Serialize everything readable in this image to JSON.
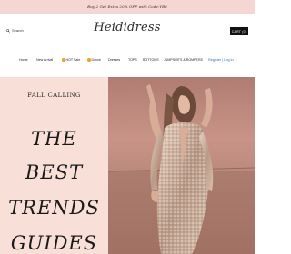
{
  "promo": {
    "text": "Buy 2 Get Extra 20% OFF with Code:YB6"
  },
  "header": {
    "search_label": "Search",
    "logo": "Heididress",
    "cart_label": "CART (0)"
  },
  "nav": {
    "items": [
      {
        "label": "Home",
        "badge": false
      },
      {
        "label": "New Arrival",
        "badge": false
      },
      {
        "label": "HOT Sale",
        "badge": true
      },
      {
        "label": "Dance",
        "badge": true
      },
      {
        "label": "Dresses",
        "badge": false
      },
      {
        "label": "TOPS",
        "badge": false
      },
      {
        "label": "BOTTOMS",
        "badge": false
      },
      {
        "label": "JUMPSUITS & ROMPERS",
        "badge": false
      }
    ],
    "auth": "Register | Log in"
  },
  "hero": {
    "kicker": "FALL CALLING",
    "lines": [
      "THE",
      "BEST",
      "TRENDS",
      "GUIDES"
    ],
    "colors": {
      "left_bg": "#f8dfd8",
      "promo_bg": "#f4d6d2",
      "accent": "#f0a12c"
    }
  }
}
